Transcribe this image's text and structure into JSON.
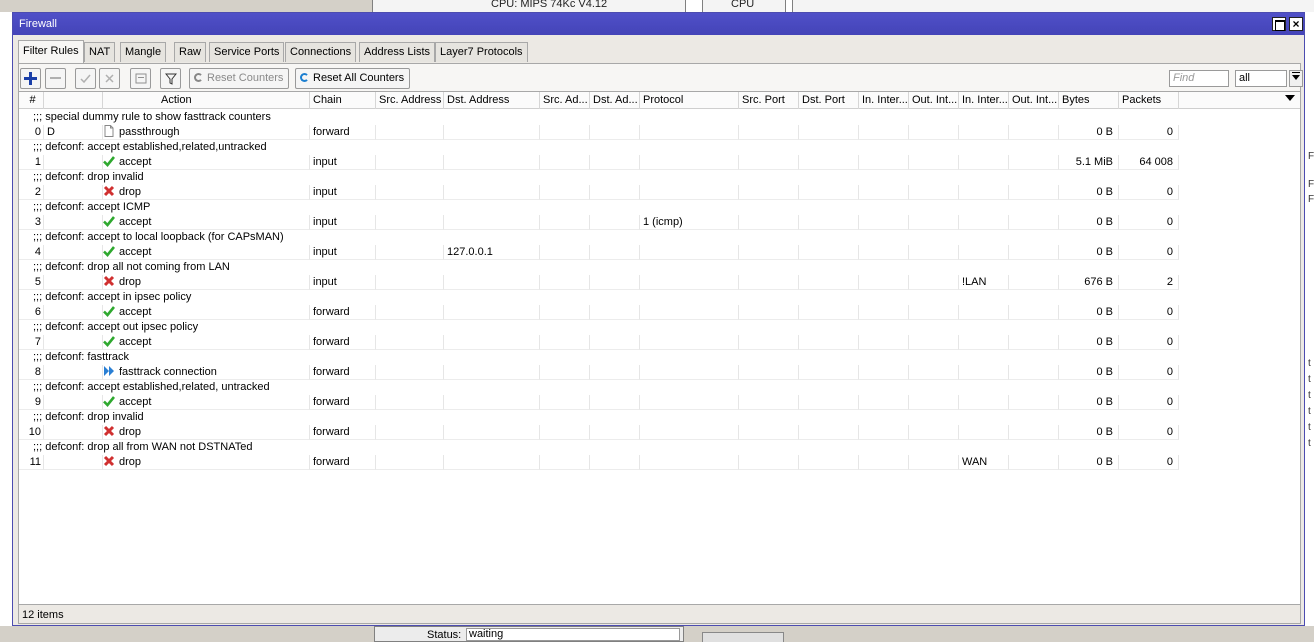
{
  "background": {
    "cpu_text": "CPU: MIPS 74Kc V4.12",
    "cpu_label": "CPU",
    "status_label": "Status:",
    "status_value": "waiting"
  },
  "window": {
    "title": "Firewall"
  },
  "tabs": [
    {
      "label": "Filter Rules",
      "active": true
    },
    {
      "label": "NAT"
    },
    {
      "label": "Mangle"
    },
    {
      "label": "Raw"
    },
    {
      "label": "Service Ports"
    },
    {
      "label": "Connections"
    },
    {
      "label": "Address Lists"
    },
    {
      "label": "Layer7 Protocols"
    }
  ],
  "toolbar": {
    "reset_counters": "Reset Counters",
    "reset_all_counters": "Reset All Counters",
    "find_placeholder": "Find",
    "filter_value": "all"
  },
  "columns": [
    "#",
    "",
    "Action",
    "Chain",
    "Src. Address",
    "Dst. Address",
    "Src. Ad...",
    "Dst. Ad...",
    "Protocol",
    "Src. Port",
    "Dst. Port",
    "In. Inter...",
    "Out. Int...",
    "In. Inter...",
    "Out. Int...",
    "Bytes",
    "Packets"
  ],
  "rules": [
    {
      "comment": ";;; special dummy rule to show fasttrack counters",
      "num": "0",
      "flag": "D",
      "action": "passthrough",
      "icon": "passthrough-icon",
      "chain": "forward",
      "dst_address": "",
      "protocol": "",
      "in_list": "",
      "bytes": "0 B",
      "packets": "0"
    },
    {
      "comment": ";;; defconf: accept established,related,untracked",
      "num": "1",
      "flag": "",
      "action": "accept",
      "icon": "check-icon",
      "chain": "input",
      "dst_address": "",
      "protocol": "",
      "in_list": "",
      "bytes": "5.1 MiB",
      "packets": "64 008"
    },
    {
      "comment": ";;; defconf: drop invalid",
      "num": "2",
      "flag": "",
      "action": "drop",
      "icon": "cross-icon",
      "chain": "input",
      "dst_address": "",
      "protocol": "",
      "in_list": "",
      "bytes": "0 B",
      "packets": "0"
    },
    {
      "comment": ";;; defconf: accept ICMP",
      "num": "3",
      "flag": "",
      "action": "accept",
      "icon": "check-icon",
      "chain": "input",
      "dst_address": "",
      "protocol": "1 (icmp)",
      "in_list": "",
      "bytes": "0 B",
      "packets": "0"
    },
    {
      "comment": ";;; defconf: accept to local loopback (for CAPsMAN)",
      "num": "4",
      "flag": "",
      "action": "accept",
      "icon": "check-icon",
      "chain": "input",
      "dst_address": "127.0.0.1",
      "protocol": "",
      "in_list": "",
      "bytes": "0 B",
      "packets": "0"
    },
    {
      "comment": ";;; defconf: drop all not coming from LAN",
      "num": "5",
      "flag": "",
      "action": "drop",
      "icon": "cross-icon",
      "chain": "input",
      "dst_address": "",
      "protocol": "",
      "in_list": "!LAN",
      "bytes": "676 B",
      "packets": "2"
    },
    {
      "comment": ";;; defconf: accept in ipsec policy",
      "num": "6",
      "flag": "",
      "action": "accept",
      "icon": "check-icon",
      "chain": "forward",
      "dst_address": "",
      "protocol": "",
      "in_list": "",
      "bytes": "0 B",
      "packets": "0"
    },
    {
      "comment": ";;; defconf: accept out ipsec policy",
      "num": "7",
      "flag": "",
      "action": "accept",
      "icon": "check-icon",
      "chain": "forward",
      "dst_address": "",
      "protocol": "",
      "in_list": "",
      "bytes": "0 B",
      "packets": "0"
    },
    {
      "comment": ";;; defconf: fasttrack",
      "num": "8",
      "flag": "",
      "action": "fasttrack connection",
      "icon": "fasttrack-icon",
      "chain": "forward",
      "dst_address": "",
      "protocol": "",
      "in_list": "",
      "bytes": "0 B",
      "packets": "0"
    },
    {
      "comment": ";;; defconf: accept established,related, untracked",
      "num": "9",
      "flag": "",
      "action": "accept",
      "icon": "check-icon",
      "chain": "forward",
      "dst_address": "",
      "protocol": "",
      "in_list": "",
      "bytes": "0 B",
      "packets": "0"
    },
    {
      "comment": ";;; defconf: drop invalid",
      "num": "10",
      "flag": "",
      "action": "drop",
      "icon": "cross-icon",
      "chain": "forward",
      "dst_address": "",
      "protocol": "",
      "in_list": "",
      "bytes": "0 B",
      "packets": "0"
    },
    {
      "comment": ";;; defconf: drop all from WAN not DSTNATed",
      "num": "11",
      "flag": "",
      "action": "drop",
      "icon": "cross-icon",
      "chain": "forward",
      "dst_address": "",
      "protocol": "",
      "in_list": "WAN",
      "bytes": "0 B",
      "packets": "0"
    }
  ],
  "status": {
    "item_count": "12 items"
  },
  "colors": {
    "title_bar": "#4444b8",
    "accept": "#2fa82f",
    "drop": "#d03030",
    "fasttrack": "#2a7fd4",
    "add_button": "#1a3fa8"
  }
}
